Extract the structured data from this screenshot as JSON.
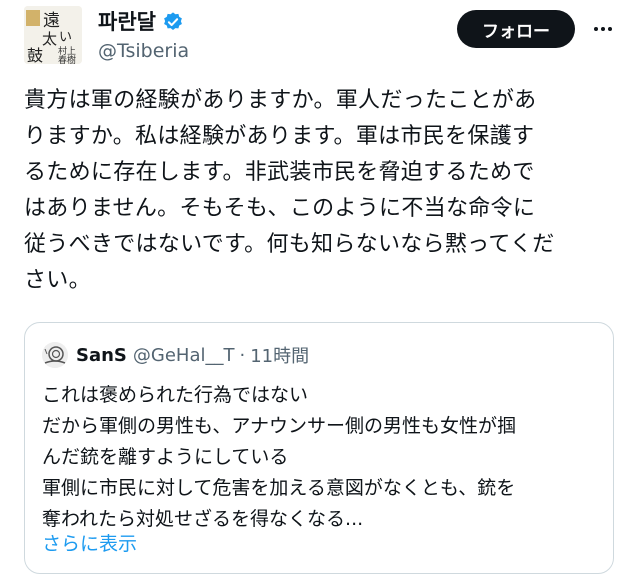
{
  "author": {
    "display_name": "파란달",
    "handle": "@Tsiberia",
    "avatar_icon": "calligraphy-avatar",
    "avatar_text": [
      "遠",
      "い",
      "太",
      "鼓",
      "村上",
      "春樹"
    ],
    "verified": true,
    "verified_color": "#1d9bf0"
  },
  "actions": {
    "follow_label": "フォロー",
    "more_icon": "more-dots-icon"
  },
  "tweet": {
    "lines": [
      "貴方は軍の経験がありますか。軍人だったことがあ",
      "りますか。私は経験があります。軍は市民を保護す",
      "るために存在します。非武装市民を脅迫するためで",
      "はありません。そもそも、このように不当な命令に",
      "従うべきではないです。何も知らないなら黙ってくだ",
      "さい。"
    ]
  },
  "quote": {
    "display_name": "SanS",
    "handle": "@GeHal__T",
    "separator": "·",
    "time": "11時間",
    "avatar_icon": "snail-avatar",
    "lines": [
      "これは褒められた行為ではない",
      "だから軍側の男性も、アナウンサー側の男性も女性が掴",
      "んだ銃を離すようにしている",
      "軍側に市民に対して危害を加える意図がなくとも、銃を",
      "奪われたら対処せざるを得なくなる..."
    ],
    "show_more_label": "さらに表示",
    "link_color": "#1d9bf0"
  }
}
